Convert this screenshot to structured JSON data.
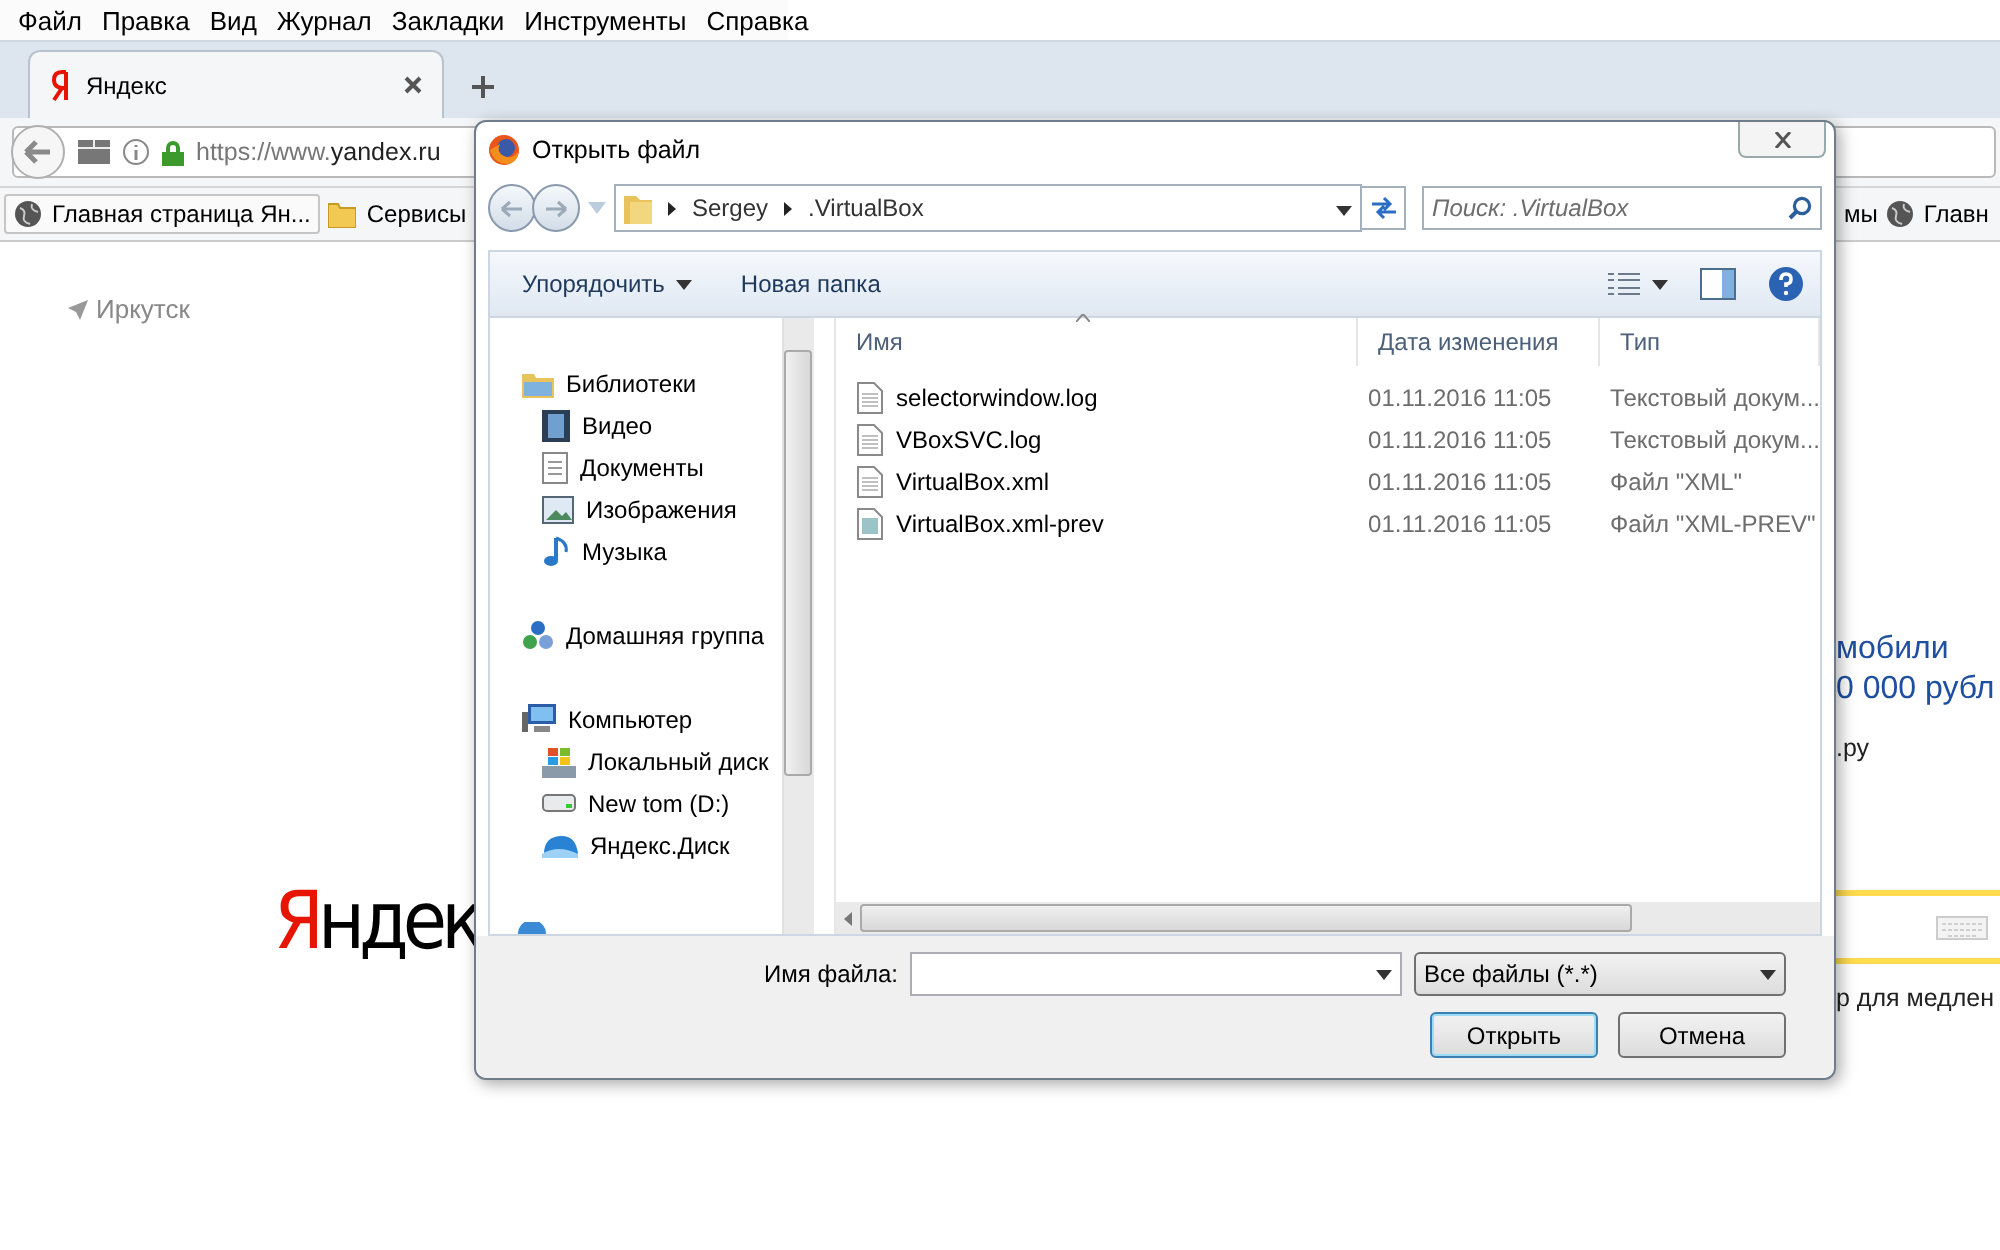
{
  "browser": {
    "menu": [
      "Файл",
      "Правка",
      "Вид",
      "Журнал",
      "Закладки",
      "Инструменты",
      "Справка"
    ],
    "tabs": [
      {
        "label": "Яндекс",
        "selected": true
      }
    ],
    "url": {
      "scheme": "https://www.",
      "host": "yandex.ru"
    },
    "bookmarks": [
      {
        "kind": "globe",
        "label": "Главная страница Ян..."
      },
      {
        "kind": "folder",
        "label": "Сервисы"
      }
    ],
    "bookmarks_right": [
      {
        "kind": "text",
        "label": "мы"
      },
      {
        "kind": "globe",
        "label": "Главн"
      }
    ]
  },
  "page": {
    "city": "Иркутск",
    "logo": {
      "first": "Я",
      "rest": "ндек"
    },
    "ad_title": [
      "мобили",
      "0 000 рубл"
    ],
    "ad_domain": ".ру",
    "search_hint": "р для медлен"
  },
  "dialog": {
    "title": "Открыть файл",
    "path": [
      "Sergey",
      ".VirtualBox"
    ],
    "search": {
      "placeholder": "Поиск: .VirtualBox"
    },
    "toolbar": {
      "organize": "Упорядочить",
      "new_folder": "Новая папка"
    },
    "nav": [
      {
        "kind": "library",
        "label": "Библиотеки",
        "children": [
          {
            "kind": "video",
            "label": "Видео"
          },
          {
            "kind": "docs",
            "label": "Документы"
          },
          {
            "kind": "images",
            "label": "Изображения"
          },
          {
            "kind": "music",
            "label": "Музыка"
          }
        ]
      },
      {
        "kind": "homegroup",
        "label": "Домашняя группа"
      },
      {
        "kind": "computer",
        "label": "Компьютер",
        "children": [
          {
            "kind": "drive",
            "label": "Локальный диск"
          },
          {
            "kind": "hdd",
            "label": "New tom (D:)"
          },
          {
            "kind": "cloud",
            "label": "Яндекс.Диск"
          }
        ]
      }
    ],
    "columns": [
      "Имя",
      "Дата изменения",
      "Тип"
    ],
    "rows": [
      {
        "name": "selectorwindow.log",
        "date": "01.11.2016 11:05",
        "type": "Текстовый докум...",
        "kind": "text"
      },
      {
        "name": "VBoxSVC.log",
        "date": "01.11.2016 11:05",
        "type": "Текстовый докум...",
        "kind": "text"
      },
      {
        "name": "VirtualBox.xml",
        "date": "01.11.2016 11:05",
        "type": "Файл \"XML\"",
        "kind": "text"
      },
      {
        "name": "VirtualBox.xml-prev",
        "date": "01.11.2016 11:05",
        "type": "Файл \"XML-PREV\"",
        "kind": "generic"
      }
    ],
    "filename_label": "Имя файла:",
    "filter": "Все файлы (*.*)",
    "buttons": [
      {
        "label": "Открыть",
        "default": true
      },
      {
        "label": "Отмена",
        "default": false
      }
    ]
  }
}
